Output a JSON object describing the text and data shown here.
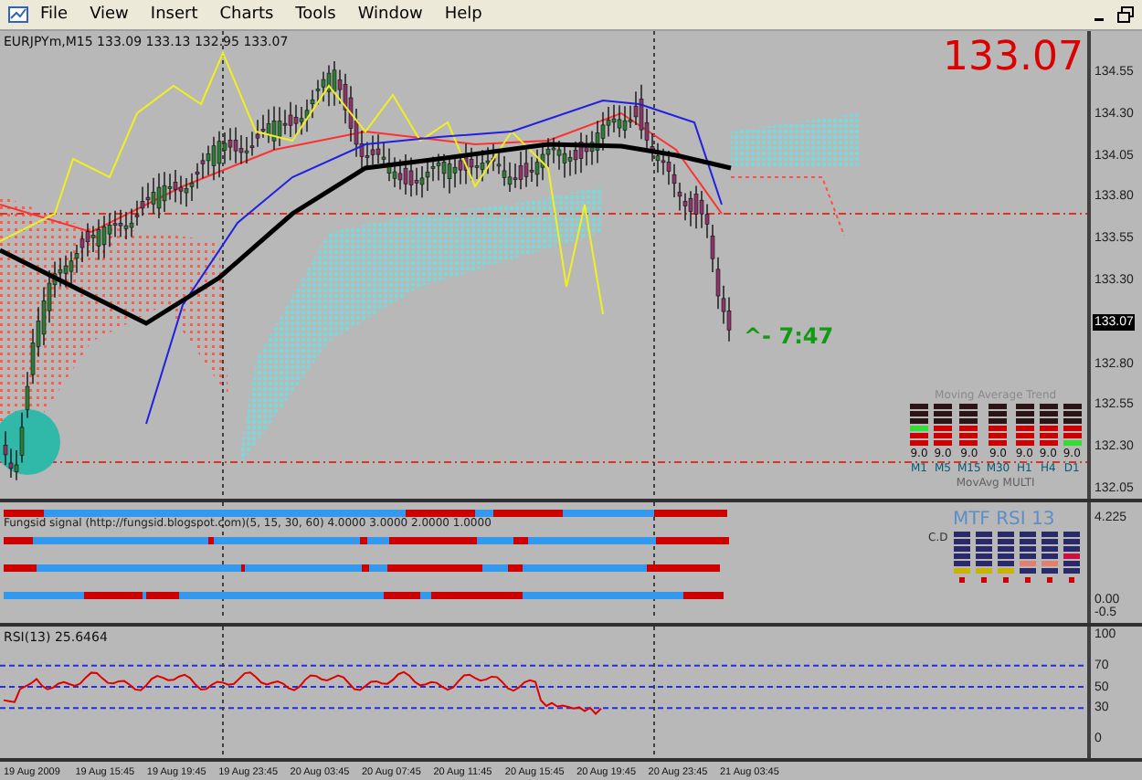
{
  "menu": {
    "items": [
      "File",
      "View",
      "Insert",
      "Charts",
      "Tools",
      "Window",
      "Help"
    ]
  },
  "main_chart": {
    "header": "EURJPYm,M15  133.09 133.13 132.95 133.07",
    "price": "133.07",
    "timer": "^- 7:47",
    "price_axis": [
      {
        "label": "134.55",
        "current": false
      },
      {
        "label": "134.30",
        "current": false
      },
      {
        "label": "134.05",
        "current": false
      },
      {
        "label": "133.80",
        "current": false
      },
      {
        "label": "133.55",
        "current": false
      },
      {
        "label": "133.30",
        "current": false
      },
      {
        "label": "133.07",
        "current": true
      },
      {
        "label": "132.80",
        "current": false
      },
      {
        "label": "132.55",
        "current": false
      },
      {
        "label": "132.30",
        "current": false
      },
      {
        "label": "132.05",
        "current": false
      }
    ],
    "ma_trend": {
      "title": "Moving Average Trend",
      "footer": "MovAvg MULTI",
      "columns": [
        {
          "value": "9.0",
          "label": "M1",
          "cells": [
            {
              "color": "#2a1416"
            },
            {
              "color": "#2a1416"
            },
            {
              "color": "#2a1416"
            },
            {
              "color": "#33dd33"
            },
            {
              "color": "#cc0000"
            },
            {
              "color": "#cc0000"
            }
          ]
        },
        {
          "value": "9.0",
          "label": "M5",
          "cells": [
            {
              "color": "#2a1416"
            },
            {
              "color": "#2a1416"
            },
            {
              "color": "#2a1416"
            },
            {
              "color": "#cc0000"
            },
            {
              "color": "#cc0000"
            },
            {
              "color": "#cc0000"
            }
          ]
        },
        {
          "value": "9.0",
          "label": "M15",
          "cells": [
            {
              "color": "#2a1416"
            },
            {
              "color": "#2a1416"
            },
            {
              "color": "#2a1416"
            },
            {
              "color": "#cc0000"
            },
            {
              "color": "#cc0000"
            },
            {
              "color": "#cc0000"
            }
          ]
        },
        {
          "value": "9.0",
          "label": "M30",
          "cells": [
            {
              "color": "#2a1416"
            },
            {
              "color": "#2a1416"
            },
            {
              "color": "#2a1416"
            },
            {
              "color": "#cc0000"
            },
            {
              "color": "#cc0000"
            },
            {
              "color": "#cc0000"
            }
          ]
        },
        {
          "value": "9.0",
          "label": "H1",
          "cells": [
            {
              "color": "#2a1416"
            },
            {
              "color": "#2a1416"
            },
            {
              "color": "#2a1416"
            },
            {
              "color": "#cc0000"
            },
            {
              "color": "#cc0000"
            },
            {
              "color": "#cc0000"
            }
          ]
        },
        {
          "value": "9.0",
          "label": "H4",
          "cells": [
            {
              "color": "#2a1416"
            },
            {
              "color": "#2a1416"
            },
            {
              "color": "#2a1416"
            },
            {
              "color": "#cc0000"
            },
            {
              "color": "#cc0000"
            },
            {
              "color": "#cc0000"
            }
          ]
        },
        {
          "value": "9.0",
          "label": "D1",
          "cells": [
            {
              "color": "#2a1416"
            },
            {
              "color": "#2a1416"
            },
            {
              "color": "#2a1416"
            },
            {
              "color": "#cc0000"
            },
            {
              "color": "#cc0000"
            },
            {
              "color": "#33dd33"
            }
          ]
        }
      ]
    }
  },
  "signal_panel": {
    "title": "Fungsid signal (http://fungsid.blogspot.com)(5, 15, 30, 60) 4.0000 3.0000 2.0000 1.0000",
    "axis": [
      "4.225",
      "0.00",
      "-0.5"
    ],
    "mtf_rsi": {
      "title": "MTF RSI  13",
      "corner": "C.D",
      "columns": [
        {
          "cells": [
            {
              "color": "#2a2a6a"
            },
            {
              "color": "#2a2a6a"
            },
            {
              "color": "#2a2a6a"
            },
            {
              "color": "#2a2a6a"
            },
            {
              "color": "#2a2a6a"
            },
            {
              "color": "#c8b400"
            },
            {
              "color": "#cc0000"
            }
          ]
        },
        {
          "cells": [
            {
              "color": "#2a2a6a"
            },
            {
              "color": "#2a2a6a"
            },
            {
              "color": "#2a2a6a"
            },
            {
              "color": "#2a2a6a"
            },
            {
              "color": "#2a2a6a"
            },
            {
              "color": "#c8b400"
            },
            {
              "color": "#cc0000"
            }
          ]
        },
        {
          "cells": [
            {
              "color": "#2a2a6a"
            },
            {
              "color": "#2a2a6a"
            },
            {
              "color": "#2a2a6a"
            },
            {
              "color": "#2a2a6a"
            },
            {
              "color": "#2a2a6a"
            },
            {
              "color": "#c8b400"
            },
            {
              "color": "#cc0000"
            }
          ]
        },
        {
          "cells": [
            {
              "color": "#2a2a6a"
            },
            {
              "color": "#2a2a6a"
            },
            {
              "color": "#2a2a6a"
            },
            {
              "color": "#2a2a6a"
            },
            {
              "color": "#e08070"
            },
            {
              "color": "#2a2a6a"
            },
            {
              "color": "#cc0000"
            }
          ]
        },
        {
          "cells": [
            {
              "color": "#2a2a6a"
            },
            {
              "color": "#2a2a6a"
            },
            {
              "color": "#2a2a6a"
            },
            {
              "color": "#2a2a6a"
            },
            {
              "color": "#e08070"
            },
            {
              "color": "#2a2a6a"
            },
            {
              "color": "#cc0000"
            }
          ]
        },
        {
          "cells": [
            {
              "color": "#2a2a6a"
            },
            {
              "color": "#2a2a6a"
            },
            {
              "color": "#2a2a6a"
            },
            {
              "color": "#cc1040"
            },
            {
              "color": "#2a2a6a"
            },
            {
              "color": "#2a2a6a"
            },
            {
              "color": "#cc0000"
            }
          ]
        }
      ]
    }
  },
  "rsi_panel": {
    "title": "RSI(13) 25.6464",
    "axis": [
      "100",
      "70",
      "50",
      "30",
      "0"
    ]
  },
  "time_axis": [
    "19 Aug 2009",
    "19 Aug 15:45",
    "19 Aug 19:45",
    "19 Aug 23:45",
    "20 Aug 03:45",
    "20 Aug 07:45",
    "20 Aug 11:45",
    "20 Aug 15:45",
    "20 Aug 19:45",
    "20 Aug 23:45",
    "21 Aug 03:45"
  ]
}
